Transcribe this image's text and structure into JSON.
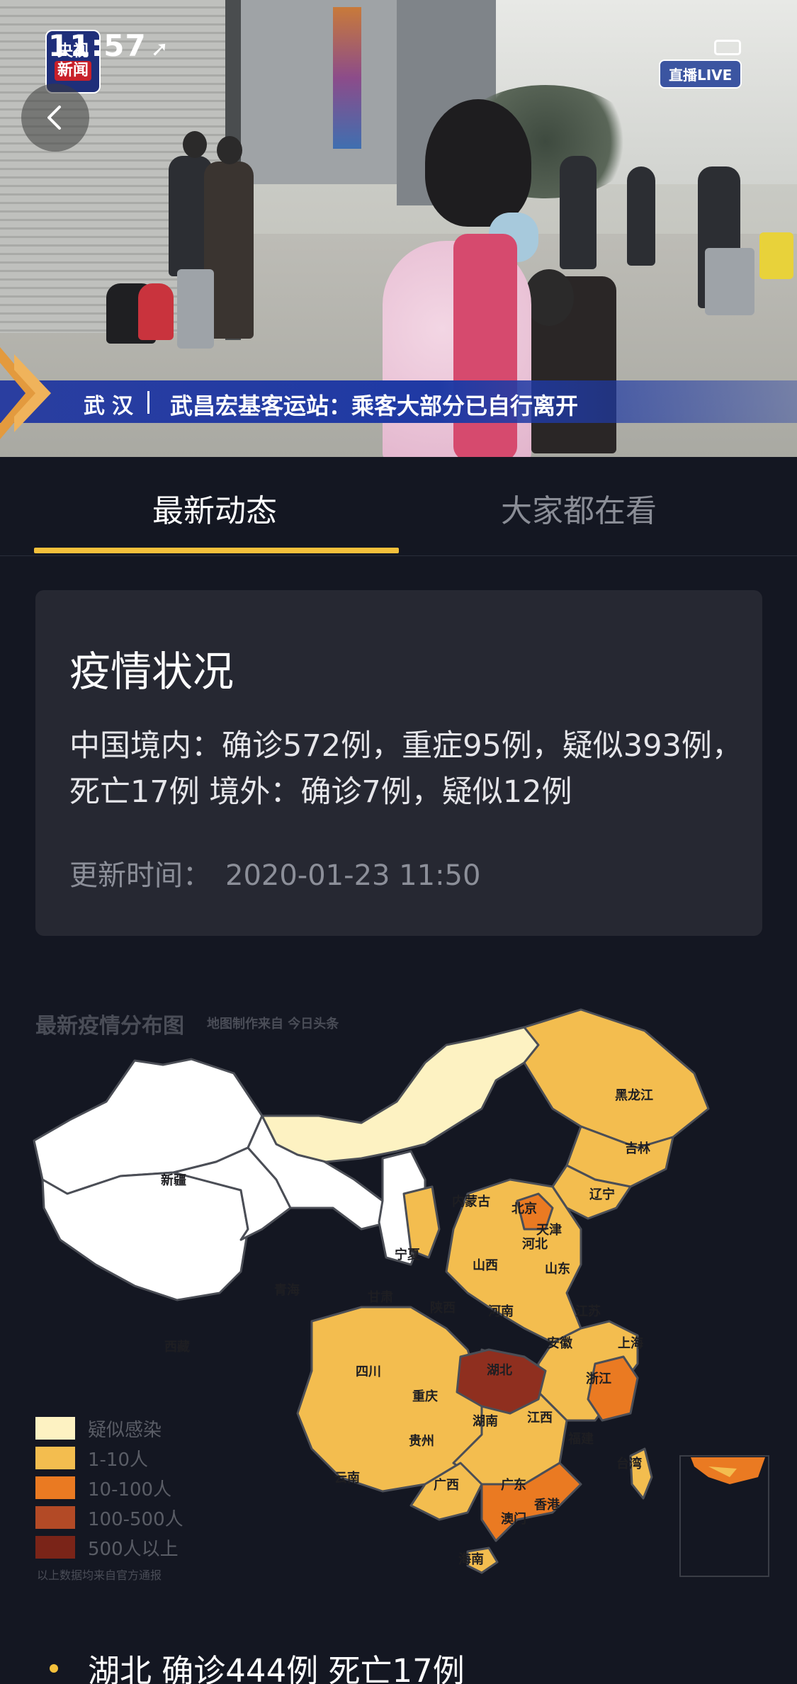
{
  "status_bar": {
    "time": "11:57"
  },
  "video": {
    "channel_logo_line1": "央视",
    "channel_logo_line2": "新闻",
    "live_badge": "直播LIVE",
    "ticker_location": "武汉",
    "ticker_headline": "武昌宏基客运站：乘客大部分已自行离开"
  },
  "tabs": [
    {
      "label": "最新动态",
      "active": true
    },
    {
      "label": "大家都在看",
      "active": false
    }
  ],
  "status_card": {
    "title": "疫情状况",
    "body": "中国境内：确诊572例，重症95例，疑似393例，死亡17例 境外：确诊7例，疑似12例",
    "update_label": "更新时间：",
    "update_time": "2020-01-23 11:50"
  },
  "map": {
    "title": "最新疫情分布图",
    "subtitle": "地图制作来自 今日头条",
    "footnote": "以上数据均来自官方通报",
    "legend": [
      {
        "label": "疑似感染",
        "color": "#fdf2c2"
      },
      {
        "label": "1-10人",
        "color": "#f3bd4f"
      },
      {
        "label": "10-100人",
        "color": "#ea7a22"
      },
      {
        "label": "100-500人",
        "color": "#b34a26"
      },
      {
        "label": "500人以上",
        "color": "#7a2418"
      }
    ],
    "province_labels": [
      "新疆",
      "西藏",
      "青海",
      "甘肃",
      "宁夏",
      "内蒙古",
      "黑龙江",
      "吉林",
      "辽宁",
      "北京",
      "天津",
      "河北",
      "山西",
      "山东",
      "陕西",
      "河南",
      "江苏",
      "上海",
      "安徽",
      "湖北",
      "四川",
      "重庆",
      "浙江",
      "湖南",
      "江西",
      "贵州",
      "福建",
      "云南",
      "广西",
      "广东",
      "台湾",
      "香港",
      "澳门",
      "海南"
    ]
  },
  "province_list": [
    {
      "text": "湖北 确诊444例 死亡17例"
    }
  ]
}
